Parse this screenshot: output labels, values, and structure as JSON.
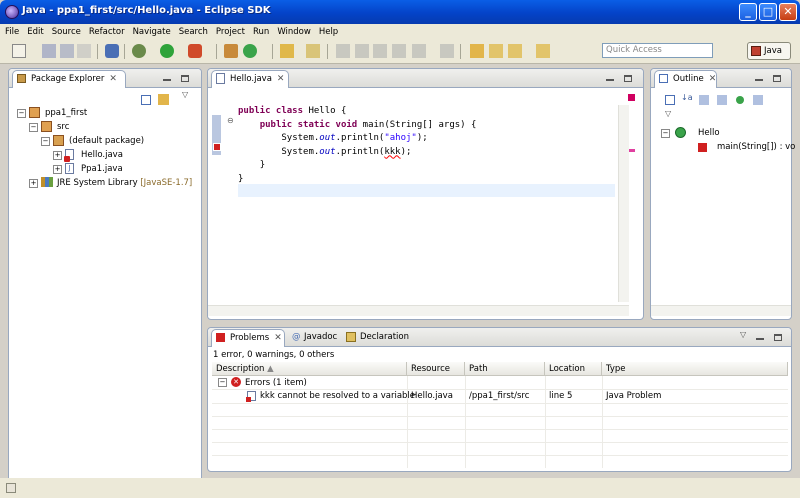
{
  "window": {
    "title": "Java - ppa1_first/src/Hello.java - Eclipse SDK"
  },
  "menu": [
    "File",
    "Edit",
    "Source",
    "Refactor",
    "Navigate",
    "Search",
    "Project",
    "Run",
    "Window",
    "Help"
  ],
  "toolbar": {
    "quick_access_placeholder": "Quick Access",
    "perspective_label": "Java"
  },
  "package_explorer": {
    "tab_label": "Package Explorer",
    "tree": {
      "project": "ppa1_first",
      "src": "src",
      "package": "(default package)",
      "file1": "Hello.java",
      "file2": "Ppa1.java",
      "library": "JRE System Library",
      "library_version": "[JavaSE-1.7]"
    }
  },
  "editor": {
    "tab_label": "Hello.java",
    "code": {
      "l1_kw": "public class",
      "l1_rest": " Hello {",
      "l2_kw": "public static void",
      "l2_rest": " main(String[] args) {",
      "l3_pre": "System.",
      "l3_field": "out",
      "l3_mid": ".println(",
      "l3_str": "\"ahoj\"",
      "l3_end": ");",
      "l4_pre": "System.",
      "l4_field": "out",
      "l4_mid": ".println(",
      "l4_err": "kkk",
      "l4_end": ");",
      "l5": "}",
      "l6": "}"
    }
  },
  "outline": {
    "tab_label": "Outline",
    "class_name": "Hello",
    "method": "main(String[]) : vo"
  },
  "bottom": {
    "tabs": {
      "problems": "Problems",
      "javadoc": "Javadoc",
      "declaration": "Declaration"
    },
    "summary": "1 error, 0 warnings, 0 others",
    "columns": {
      "description": "Description",
      "resource": "Resource",
      "path": "Path",
      "location": "Location",
      "type": "Type"
    },
    "group": "Errors (1 item)",
    "problem": {
      "description": "kkk cannot be resolved to a variable",
      "resource": "Hello.java",
      "path": "/ppa1_first/src",
      "location": "line 5",
      "type": "Java Problem"
    }
  },
  "colors": {
    "titlebar": "#0443c8",
    "keyword": "#7f0055",
    "string": "#2a00ff",
    "field": "#0000c0",
    "error": "#cc0000"
  }
}
